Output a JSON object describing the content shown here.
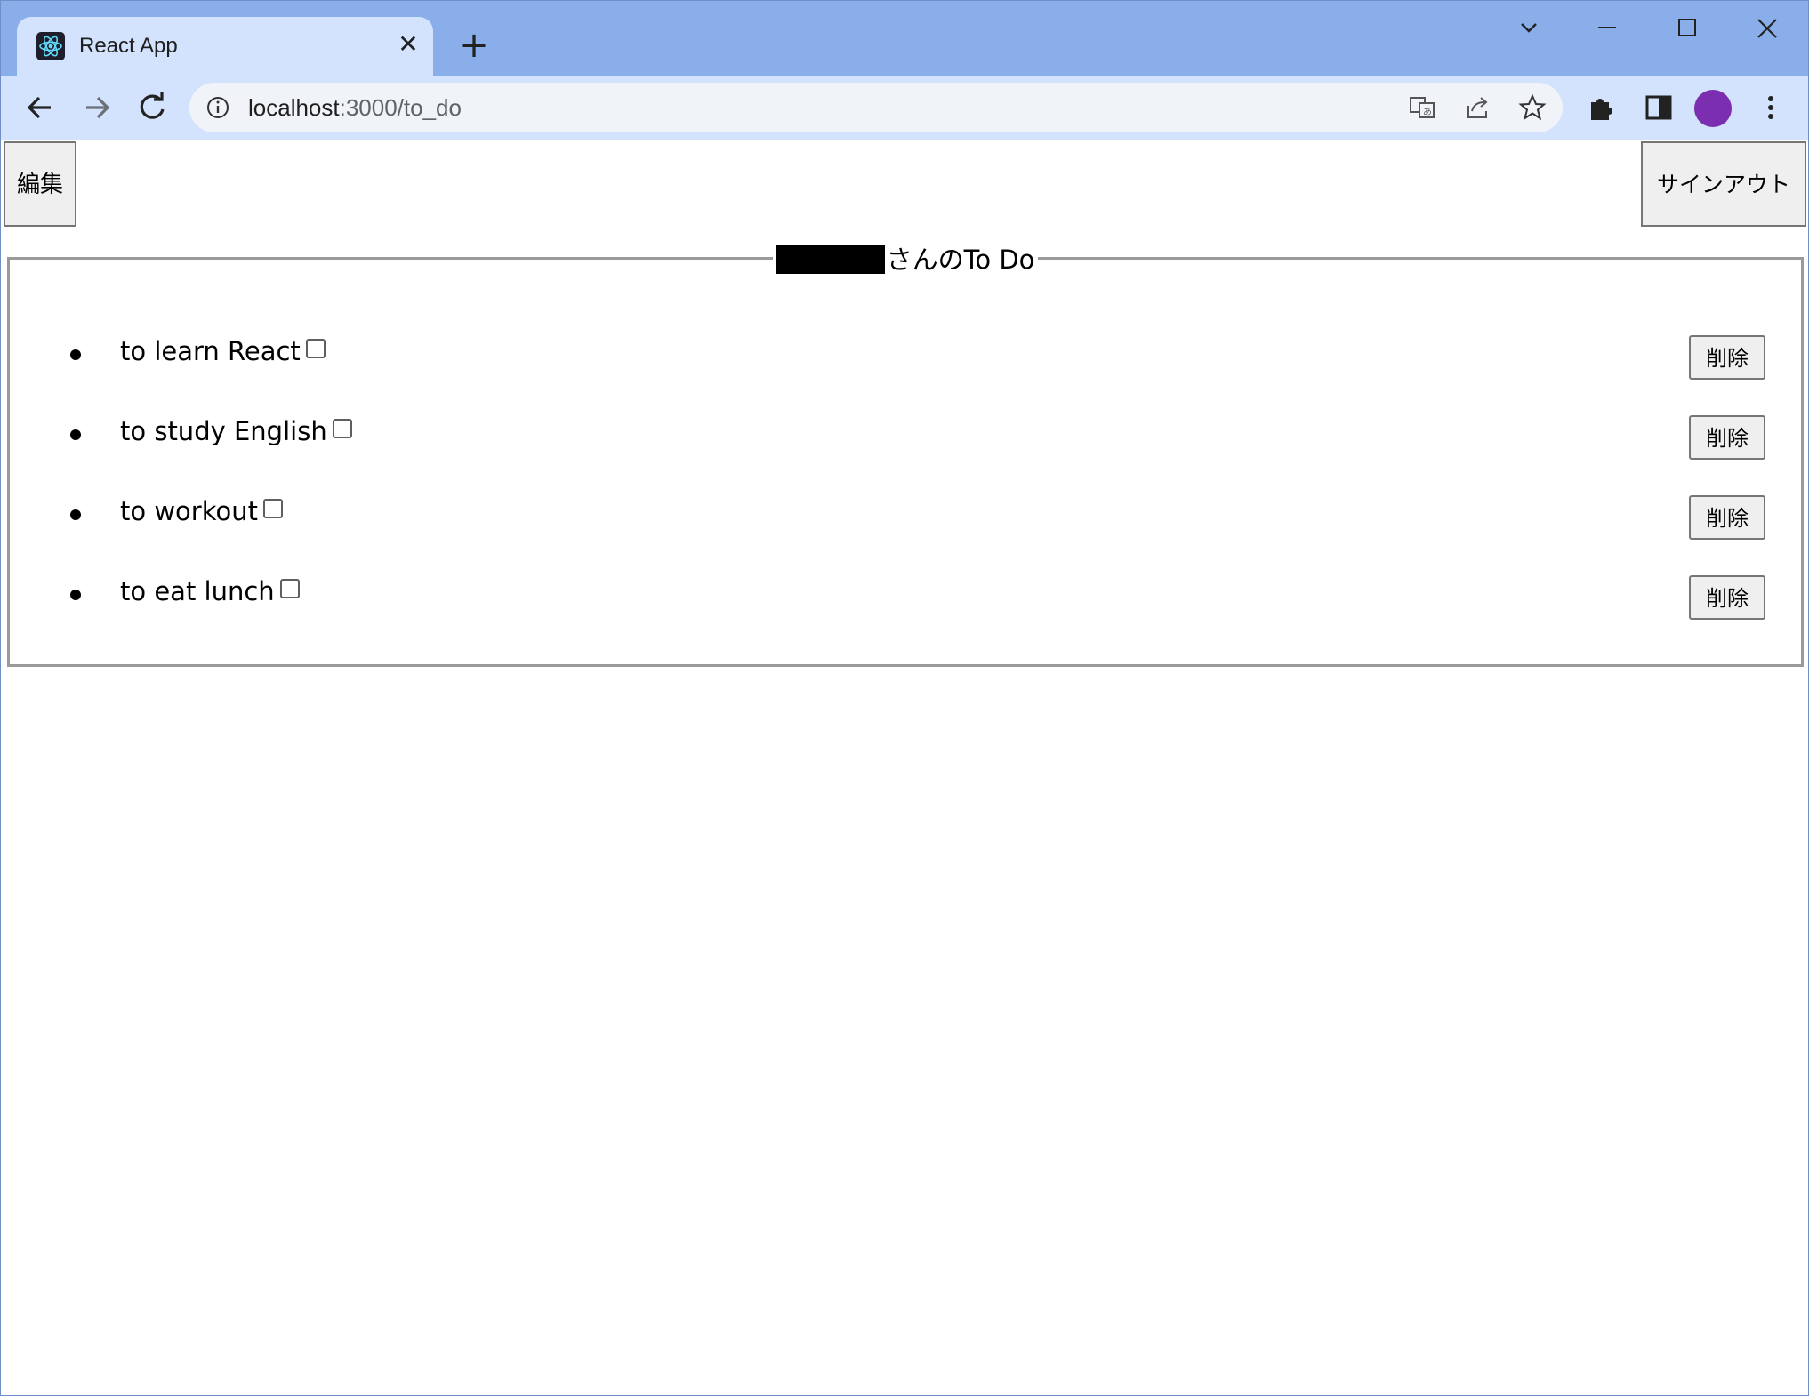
{
  "browser": {
    "tab_title": "React App",
    "close_tab_glyph": "✕",
    "new_tab_glyph": "+",
    "url_host": "localhost",
    "url_path": ":3000/to_do",
    "favicon": "react-icon",
    "avatar_color": "#7b2fb0"
  },
  "page": {
    "edit_button": "編集",
    "signout_button": "サインアウト",
    "legend_suffix": "さんのTo Do",
    "items": [
      {
        "label": "to learn React",
        "checked": false,
        "delete_label": "削除"
      },
      {
        "label": "to study English",
        "checked": false,
        "delete_label": "削除"
      },
      {
        "label": "to workout",
        "checked": false,
        "delete_label": "削除"
      },
      {
        "label": "to eat lunch",
        "checked": false,
        "delete_label": "削除"
      }
    ]
  }
}
